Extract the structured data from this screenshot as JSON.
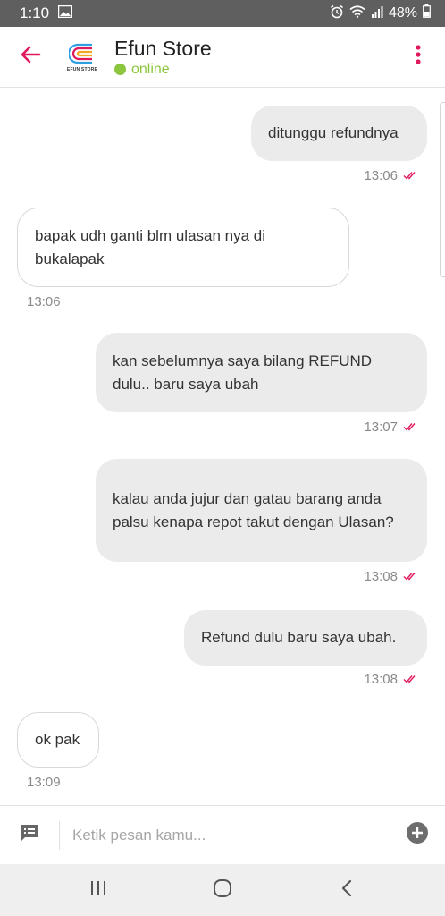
{
  "status_bar": {
    "time": "1:10",
    "battery": "48%"
  },
  "header": {
    "store_name": "Efun Store",
    "status": "online",
    "logo_text": "EFUN STORE"
  },
  "messages": [
    {
      "dir": "out",
      "text": "ditunggu refundnya",
      "time": "13:06"
    },
    {
      "dir": "in",
      "text": "bapak udh ganti blm ulasan nya di bukalapak",
      "time": "13:06"
    },
    {
      "dir": "out",
      "text": "kan sebelumnya saya bilang REFUND dulu.. baru saya ubah",
      "time": "13:07"
    },
    {
      "dir": "out",
      "text": "kalau anda jujur dan gatau barang anda palsu kenapa repot takut dengan Ulasan?",
      "time": "13:08"
    },
    {
      "dir": "out",
      "text": "Refund dulu baru saya ubah.",
      "time": "13:08"
    },
    {
      "dir": "in",
      "text": "ok pak",
      "time": "13:09"
    }
  ],
  "input": {
    "placeholder": "Ketik pesan kamu..."
  },
  "colors": {
    "accent": "#e0195a",
    "online": "#8cc63f",
    "status_bar": "#5f5f5f",
    "bubble_out": "#ebebeb"
  },
  "icons": {
    "back": "arrow-left-icon",
    "menu": "more-vertical-icon",
    "chat": "message-icon",
    "add": "plus-circle-icon",
    "read": "double-check-icon",
    "nav_recent": "recent-apps-icon",
    "nav_home": "home-icon",
    "nav_back": "back-icon"
  }
}
